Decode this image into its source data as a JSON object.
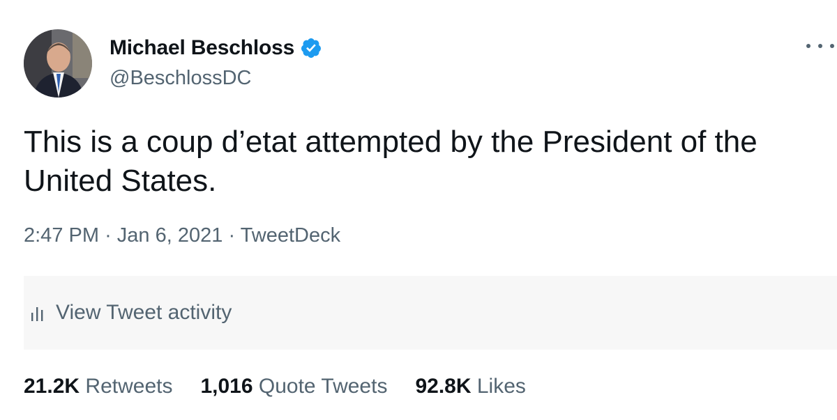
{
  "tweet": {
    "author": {
      "display_name": "Michael Beschloss",
      "handle": "@BeschlossDC",
      "verified": true,
      "avatar_icon": "profile-photo"
    },
    "more_icon": "ellipsis-icon",
    "text": "This is a coup d’etat attempted by the President of the United States.",
    "meta": {
      "time": "2:47 PM",
      "separator": "·",
      "date": "Jan 6, 2021",
      "source": "TweetDeck"
    },
    "activity": {
      "icon": "bar-chart-icon",
      "label": "View Tweet activity"
    },
    "stats": {
      "retweets": {
        "count": "21.2K",
        "label": "Retweets"
      },
      "quotes": {
        "count": "1,016",
        "label": "Quote Tweets"
      },
      "likes": {
        "count": "92.8K",
        "label": "Likes"
      }
    }
  },
  "colors": {
    "text": "#0f1419",
    "secondary": "#536471",
    "verified": "#1d9bf0",
    "activity_bg": "#f7f7f7"
  }
}
